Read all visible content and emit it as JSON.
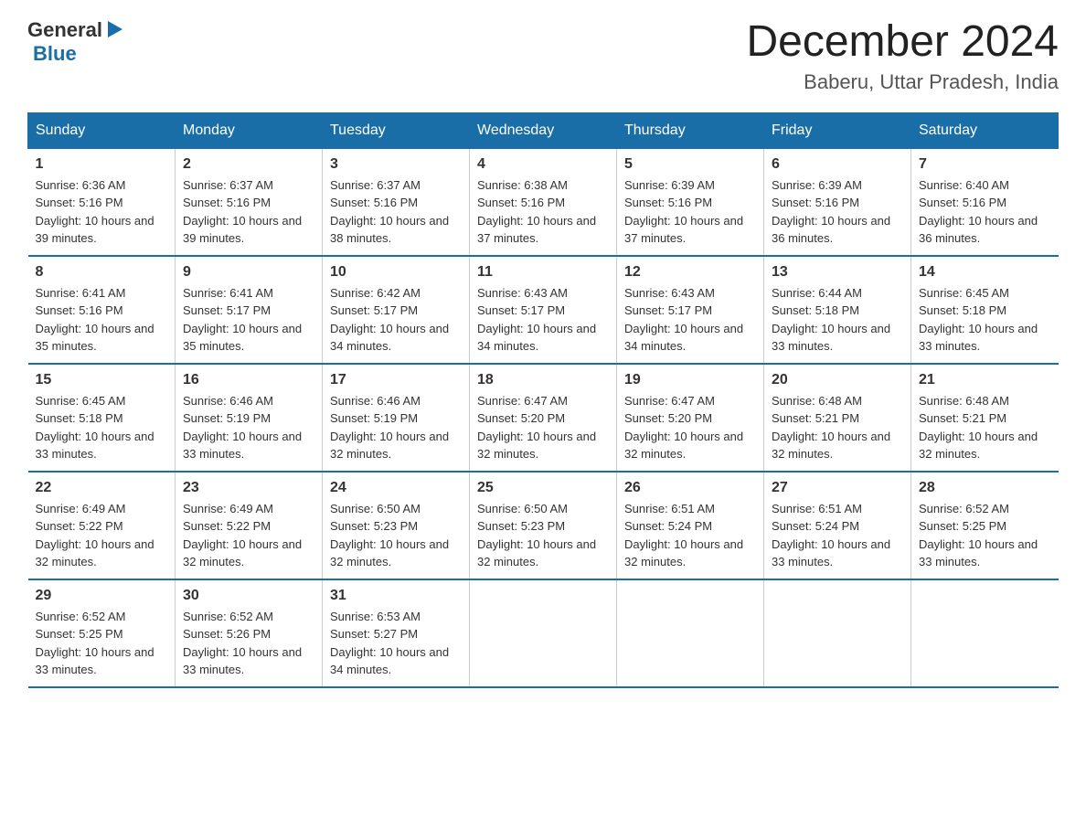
{
  "logo": {
    "general": "General",
    "blue": "Blue",
    "arrow": "▶"
  },
  "title": "December 2024",
  "location": "Baberu, Uttar Pradesh, India",
  "days_of_week": [
    "Sunday",
    "Monday",
    "Tuesday",
    "Wednesday",
    "Thursday",
    "Friday",
    "Saturday"
  ],
  "weeks": [
    [
      {
        "day": "1",
        "sunrise": "6:36 AM",
        "sunset": "5:16 PM",
        "daylight": "10 hours and 39 minutes."
      },
      {
        "day": "2",
        "sunrise": "6:37 AM",
        "sunset": "5:16 PM",
        "daylight": "10 hours and 39 minutes."
      },
      {
        "day": "3",
        "sunrise": "6:37 AM",
        "sunset": "5:16 PM",
        "daylight": "10 hours and 38 minutes."
      },
      {
        "day": "4",
        "sunrise": "6:38 AM",
        "sunset": "5:16 PM",
        "daylight": "10 hours and 37 minutes."
      },
      {
        "day": "5",
        "sunrise": "6:39 AM",
        "sunset": "5:16 PM",
        "daylight": "10 hours and 37 minutes."
      },
      {
        "day": "6",
        "sunrise": "6:39 AM",
        "sunset": "5:16 PM",
        "daylight": "10 hours and 36 minutes."
      },
      {
        "day": "7",
        "sunrise": "6:40 AM",
        "sunset": "5:16 PM",
        "daylight": "10 hours and 36 minutes."
      }
    ],
    [
      {
        "day": "8",
        "sunrise": "6:41 AM",
        "sunset": "5:16 PM",
        "daylight": "10 hours and 35 minutes."
      },
      {
        "day": "9",
        "sunrise": "6:41 AM",
        "sunset": "5:17 PM",
        "daylight": "10 hours and 35 minutes."
      },
      {
        "day": "10",
        "sunrise": "6:42 AM",
        "sunset": "5:17 PM",
        "daylight": "10 hours and 34 minutes."
      },
      {
        "day": "11",
        "sunrise": "6:43 AM",
        "sunset": "5:17 PM",
        "daylight": "10 hours and 34 minutes."
      },
      {
        "day": "12",
        "sunrise": "6:43 AM",
        "sunset": "5:17 PM",
        "daylight": "10 hours and 34 minutes."
      },
      {
        "day": "13",
        "sunrise": "6:44 AM",
        "sunset": "5:18 PM",
        "daylight": "10 hours and 33 minutes."
      },
      {
        "day": "14",
        "sunrise": "6:45 AM",
        "sunset": "5:18 PM",
        "daylight": "10 hours and 33 minutes."
      }
    ],
    [
      {
        "day": "15",
        "sunrise": "6:45 AM",
        "sunset": "5:18 PM",
        "daylight": "10 hours and 33 minutes."
      },
      {
        "day": "16",
        "sunrise": "6:46 AM",
        "sunset": "5:19 PM",
        "daylight": "10 hours and 33 minutes."
      },
      {
        "day": "17",
        "sunrise": "6:46 AM",
        "sunset": "5:19 PM",
        "daylight": "10 hours and 32 minutes."
      },
      {
        "day": "18",
        "sunrise": "6:47 AM",
        "sunset": "5:20 PM",
        "daylight": "10 hours and 32 minutes."
      },
      {
        "day": "19",
        "sunrise": "6:47 AM",
        "sunset": "5:20 PM",
        "daylight": "10 hours and 32 minutes."
      },
      {
        "day": "20",
        "sunrise": "6:48 AM",
        "sunset": "5:21 PM",
        "daylight": "10 hours and 32 minutes."
      },
      {
        "day": "21",
        "sunrise": "6:48 AM",
        "sunset": "5:21 PM",
        "daylight": "10 hours and 32 minutes."
      }
    ],
    [
      {
        "day": "22",
        "sunrise": "6:49 AM",
        "sunset": "5:22 PM",
        "daylight": "10 hours and 32 minutes."
      },
      {
        "day": "23",
        "sunrise": "6:49 AM",
        "sunset": "5:22 PM",
        "daylight": "10 hours and 32 minutes."
      },
      {
        "day": "24",
        "sunrise": "6:50 AM",
        "sunset": "5:23 PM",
        "daylight": "10 hours and 32 minutes."
      },
      {
        "day": "25",
        "sunrise": "6:50 AM",
        "sunset": "5:23 PM",
        "daylight": "10 hours and 32 minutes."
      },
      {
        "day": "26",
        "sunrise": "6:51 AM",
        "sunset": "5:24 PM",
        "daylight": "10 hours and 32 minutes."
      },
      {
        "day": "27",
        "sunrise": "6:51 AM",
        "sunset": "5:24 PM",
        "daylight": "10 hours and 33 minutes."
      },
      {
        "day": "28",
        "sunrise": "6:52 AM",
        "sunset": "5:25 PM",
        "daylight": "10 hours and 33 minutes."
      }
    ],
    [
      {
        "day": "29",
        "sunrise": "6:52 AM",
        "sunset": "5:25 PM",
        "daylight": "10 hours and 33 minutes."
      },
      {
        "day": "30",
        "sunrise": "6:52 AM",
        "sunset": "5:26 PM",
        "daylight": "10 hours and 33 minutes."
      },
      {
        "day": "31",
        "sunrise": "6:53 AM",
        "sunset": "5:27 PM",
        "daylight": "10 hours and 34 minutes."
      },
      null,
      null,
      null,
      null
    ]
  ],
  "cell_labels": {
    "sunrise": "Sunrise:",
    "sunset": "Sunset:",
    "daylight": "Daylight:"
  }
}
